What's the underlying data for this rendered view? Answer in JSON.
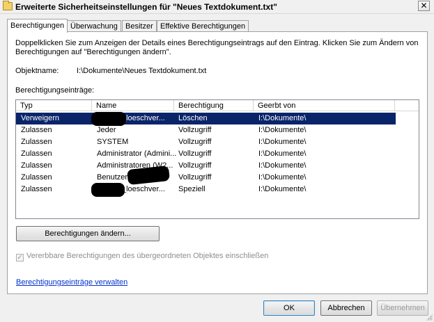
{
  "window": {
    "title": "Erweiterte Sicherheitseinstellungen für \"Neues Textdokument.txt\"",
    "close_glyph": "✕",
    "icon": "folder-icon"
  },
  "tabs": [
    {
      "label": "Berechtigungen",
      "active": true
    },
    {
      "label": "Überwachung",
      "active": false
    },
    {
      "label": "Besitzer",
      "active": false
    },
    {
      "label": "Effektive Berechtigungen",
      "active": false
    }
  ],
  "main": {
    "description": "Doppelklicken Sie zum Anzeigen der Details eines Berechtigungseintrags auf den Eintrag. Klicken Sie zum Ändern von Berechtigungen auf \"Berechtigungen ändern\".",
    "object_label": "Objektname:",
    "object_value": "I:\\Dokumente\\Neues Textdokument.txt",
    "entries_label": "Berechtigungseinträge:",
    "columns": [
      "Typ",
      "Name",
      "Berechtigung",
      "Geerbt von"
    ],
    "rows": [
      {
        "type": "Verweigern",
        "name": "_loeschver...",
        "permission": "Löschen",
        "inherited": "I:\\Dokumente\\",
        "selected": true,
        "redacted": true
      },
      {
        "type": "Zulassen",
        "name": "Jeder",
        "permission": "Vollzugriff",
        "inherited": "I:\\Dokumente\\",
        "selected": false,
        "redacted": false
      },
      {
        "type": "Zulassen",
        "name": "SYSTEM",
        "permission": "Vollzugriff",
        "inherited": "I:\\Dokumente\\",
        "selected": false,
        "redacted": false
      },
      {
        "type": "Zulassen",
        "name": "Administrator (Admini...",
        "permission": "Vollzugriff",
        "inherited": "I:\\Dokumente\\",
        "selected": false,
        "redacted": false
      },
      {
        "type": "Zulassen",
        "name": "Administratoren (W2...",
        "permission": "Vollzugriff",
        "inherited": "I:\\Dokumente\\",
        "selected": false,
        "redacted": false
      },
      {
        "type": "Zulassen",
        "name": "Benutzer",
        "permission": "Vollzugriff",
        "inherited": "I:\\Dokumente\\",
        "selected": false,
        "redacted": true
      },
      {
        "type": "Zulassen",
        "name": "_loeschver...",
        "permission": "Speziell",
        "inherited": "I:\\Dokumente\\",
        "selected": false,
        "redacted": true
      }
    ],
    "change_button": "Berechtigungen ändern...",
    "inherit_checkbox": {
      "label": "Vererbbare Berechtigungen des übergeordneten Objektes einschließen",
      "checked": true,
      "enabled": false,
      "check_glyph": "✓"
    },
    "manage_link": "Berechtigungseinträge verwalten"
  },
  "footer": {
    "ok": "OK",
    "cancel": "Abbrechen",
    "apply": "Übernehmen"
  },
  "colors": {
    "selection": "#0a246a",
    "link": "#0033cc",
    "background": "#f0f0f0"
  }
}
